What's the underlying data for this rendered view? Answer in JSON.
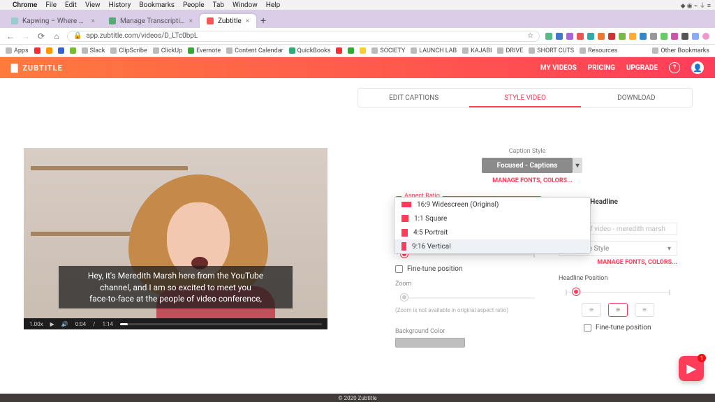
{
  "os_menu": {
    "items": [
      "Chrome",
      "File",
      "Edit",
      "View",
      "History",
      "Bookmarks",
      "People",
      "Tab",
      "Window",
      "Help"
    ]
  },
  "browser": {
    "tabs": [
      {
        "title": "Kapwing – Where Content Cre…"
      },
      {
        "title": "Manage Transcriptions – ClipS…"
      },
      {
        "title": "Zubtitle"
      }
    ],
    "url": "app.zubtitle.com/videos/D_LTc0bpL",
    "bookmarks": [
      "Apps",
      "",
      "",
      "",
      "",
      "Slack",
      "ClipScribe",
      "ClickUp",
      "Evernote",
      "Content Calendar",
      "QuickBooks",
      "",
      "",
      "",
      "SOCIETY",
      "LAUNCH LAB",
      "KAJABI",
      "DRIVE",
      "SHORT CUTS",
      "Resources"
    ],
    "bookmarks_right": "Other Bookmarks"
  },
  "app": {
    "brand": "ZUBTITLE",
    "nav": {
      "videos": "MY VIDEOS",
      "pricing": "PRICING",
      "upgrade": "UPGRADE"
    }
  },
  "tabs": {
    "edit": "EDIT CAPTIONS",
    "style": "STYLE VIDEO",
    "download": "DOWNLOAD"
  },
  "video": {
    "caption_lines": [
      "Hey, it's Meredith Marsh here from the YouTube",
      "channel, and I am so excited to meet you",
      "face-to-face at the people of video conference,"
    ],
    "speed": "1.00x",
    "elapsed": "0:04",
    "duration": "1:14"
  },
  "caption_style": {
    "label": "Caption Style",
    "value": "Focused - Captions",
    "manage": "MANAGE FONTS, COLORS..."
  },
  "aspect": {
    "label": "Aspect Ratio",
    "options": [
      {
        "swclass": "sw-169",
        "label": "16:9 Widescreen (Original)"
      },
      {
        "swclass": "sw-11",
        "label": "1:1 Square"
      },
      {
        "swclass": "sw-45",
        "label": "4:5 Portrait"
      },
      {
        "swclass": "sw-916",
        "label": "9:16 Vertical"
      }
    ]
  },
  "caption_position": {
    "finetune": "Fine-tune position"
  },
  "zoom": {
    "label": "Zoom",
    "note": "(Zoom is not available in original aspect ratio)"
  },
  "bgcolor": {
    "label": "Background Color"
  },
  "headline": {
    "add": "Add a Headline",
    "field_label": "Headline",
    "placeholder": "people of video - meredith marsh",
    "style_label": "Headline Style",
    "manage": "MANAGE FONTS, COLORS..."
  },
  "headline_position": {
    "label": "Headline Position",
    "finetune": "Fine-tune position"
  },
  "footer": "© 2020 Zubtitle",
  "chat_badge": "1"
}
